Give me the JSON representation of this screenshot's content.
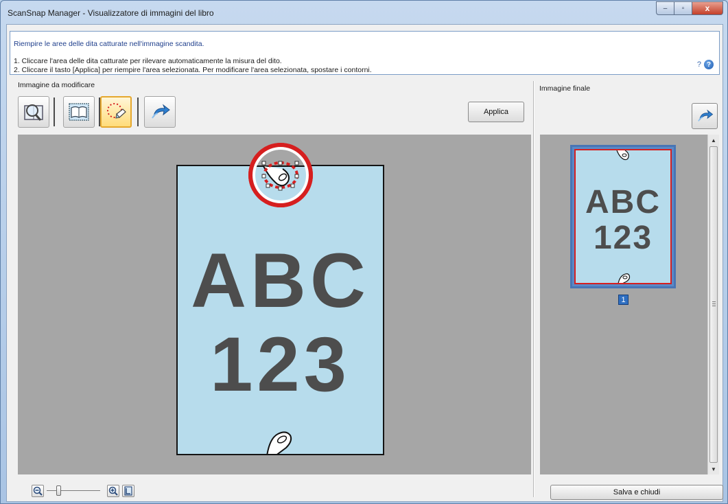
{
  "window": {
    "title": "ScanSnap Manager - Visualizzatore di immagini del libro",
    "controls": {
      "minimize": "–",
      "maximize": "▫",
      "close": "x"
    }
  },
  "instructions": {
    "title": "Riempire le aree delle dita catturate nell'immagine scandita.",
    "step1": "1. Cliccare l'area delle dita catturate per rilevare automaticamente la misura del dito.",
    "step2": "2. Cliccare il tasto [Applica] per riempire l'area selezionata. Per modificare l'area selezionata, spostare i contorni.",
    "help_text": "?",
    "help_icon_glyph": "?"
  },
  "left_panel": {
    "label": "Immagine da modificare",
    "tools": [
      {
        "name": "magnify-page-icon"
      },
      {
        "name": "book-crop-icon"
      },
      {
        "name": "finger-point-removal-icon",
        "active": true
      },
      {
        "name": "undo-icon"
      }
    ],
    "apply_button": "Applica",
    "page": {
      "letters": "ABC",
      "digits": "123"
    }
  },
  "right_panel": {
    "label": "Immagine finale",
    "thumbnail": {
      "letters": "ABC",
      "digits": "123",
      "page_number": "1"
    }
  },
  "footer": {
    "save_close_button": "Salva e chiudi"
  },
  "colors": {
    "page_bg": "#b7dcec",
    "selection_red": "#d61f1f",
    "thumbnail_blue": "#4875b5",
    "canvas_gray": "#a6a6a6"
  }
}
